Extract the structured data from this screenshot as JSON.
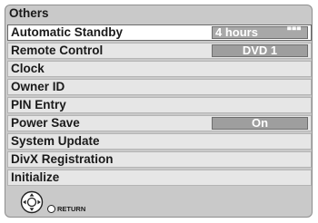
{
  "menu": {
    "title": "Others",
    "items": [
      {
        "label": "Automatic Standby",
        "value": "4 hours"
      },
      {
        "label": "Remote Control",
        "value": "DVD 1"
      },
      {
        "label": "Clock"
      },
      {
        "label": "Owner ID"
      },
      {
        "label": "PIN Entry"
      },
      {
        "label": "Power Save",
        "value": "On"
      },
      {
        "label": "System Update"
      },
      {
        "label": "DivX Registration"
      },
      {
        "label": "Initialize"
      }
    ],
    "selected_index": 0
  },
  "footer": {
    "dpad_icon": "dpad-icon",
    "return_icon": "return-circle-icon",
    "return_label": "RETURN"
  },
  "colors": {
    "panel": "#c9c9c9",
    "row": "#e6e6e6",
    "selected_row": "#ffffff",
    "value_box": "#9e9e9e",
    "value_text": "#ffffff"
  }
}
